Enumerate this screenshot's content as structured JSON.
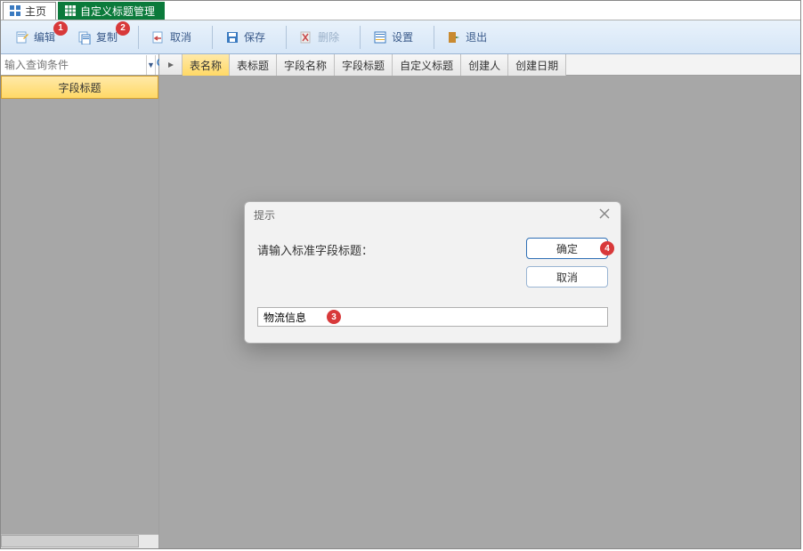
{
  "tabs": {
    "home": "主页",
    "custom_title_mgmt": "自定义标题管理"
  },
  "toolbar": {
    "edit": "编辑",
    "copy": "复制",
    "cancel": "取消",
    "save": "保存",
    "delete": "删除",
    "settings": "设置",
    "exit": "退出"
  },
  "badges": {
    "edit": "1",
    "copy": "2",
    "input": "3",
    "ok": "4"
  },
  "sidebar": {
    "search_placeholder": "输入查询条件",
    "header": "字段标题"
  },
  "grid": {
    "columns": [
      "表名称",
      "表标题",
      "字段名称",
      "字段标题",
      "自定义标题",
      "创建人",
      "创建日期"
    ]
  },
  "dialog": {
    "title": "提示",
    "label": "请输入标准字段标题：",
    "ok": "确定",
    "cancel": "取消",
    "input_value": "物流信息"
  }
}
